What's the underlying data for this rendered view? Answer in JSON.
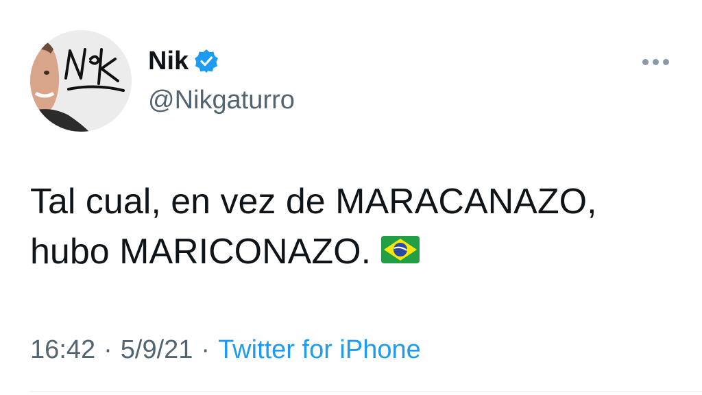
{
  "author": {
    "display_name": "Nik",
    "handle": "@Nikgaturro",
    "verified": true,
    "avatar_signature": "Nik"
  },
  "tweet": {
    "text_line_1": "Tal cual, en vez de MARACANAZO,",
    "text_line_2": "hubo MARICONAZO.",
    "emoji": "brazil-flag"
  },
  "meta": {
    "time": "16:42",
    "date": "5/9/21",
    "separator": "·",
    "source": "Twitter for iPhone"
  },
  "colors": {
    "text": "#0f1419",
    "secondary": "#536471",
    "accent": "#1d9bf0"
  },
  "icons": {
    "verified": "verified-badge-icon",
    "more": "more-options-icon"
  }
}
